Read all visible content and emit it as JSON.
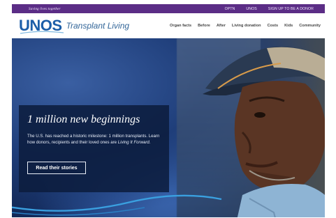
{
  "topbar": {
    "tagline": "Saving lives together",
    "links": [
      "OPTN",
      "UNOS",
      "SIGN UP TO BE A DONOR"
    ]
  },
  "header": {
    "logo": "UNOS",
    "subtitle": "Transplant Living",
    "nav": [
      "Organ facts",
      "Before",
      "After",
      "Living donation",
      "Costs",
      "Kids",
      "Community"
    ]
  },
  "hero": {
    "title": "1 million new beginnings",
    "text_main": "The U.S. has reached a historic milestone: 1 million transplants. Learn how donors, recipients and their loved ones are ",
    "text_italic": "Living It Forward",
    "text_end": ".",
    "button": "Read their stories"
  },
  "colors": {
    "topbar": "#5b2d86",
    "brand_blue": "#1c5ea8",
    "card": "#0c1c3c"
  }
}
